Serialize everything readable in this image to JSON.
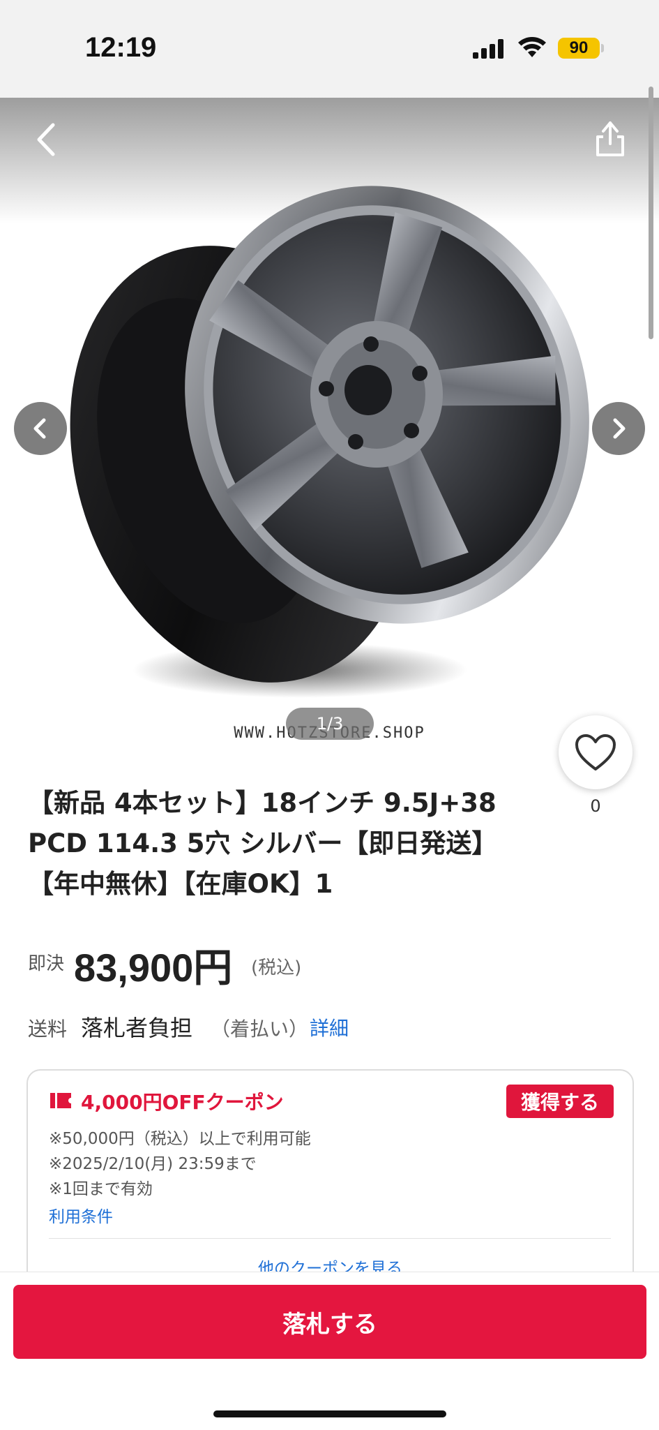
{
  "status_bar": {
    "time": "12:19",
    "battery": "90"
  },
  "gallery": {
    "watermark": "WWW.HOTZSTORE.SHOP",
    "page_indicator": "1/3"
  },
  "favorite": {
    "count": "0"
  },
  "product": {
    "title_lines": [
      "【新品 4本セット】18インチ 9.5J+38",
      "PCD 114.3 5穴 シルバー【即日発送】",
      "【年中無休】【在庫OK】1"
    ],
    "price_label": "即決",
    "price": "83,900円",
    "price_tax": "(税込)",
    "shipping_label": "送料",
    "shipping_value": "落札者負担",
    "shipping_note": "（着払い）",
    "shipping_detail_link": "詳細"
  },
  "coupon": {
    "title": "4,000円OFFクーポン",
    "get_button": "獲得する",
    "notes": [
      "※50,000円（税込）以上で利用可能",
      "※2025/2/10(月) 23:59まで",
      "※1回まで有効"
    ],
    "terms_link": "利用条件",
    "more_link": "他のクーポンを見る"
  },
  "bottom": {
    "bid_button": "落札する"
  },
  "colors": {
    "accent": "#e4163f",
    "link": "#1e6fd6",
    "battery": "#f5c400"
  }
}
